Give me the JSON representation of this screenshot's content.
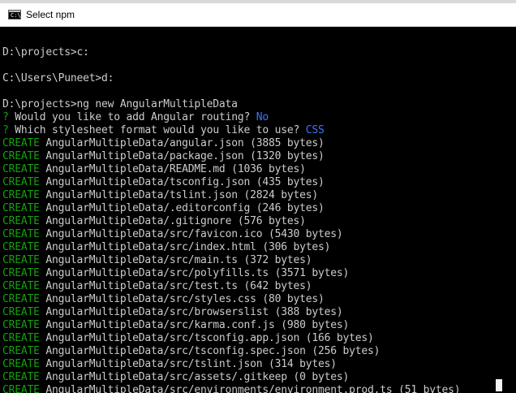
{
  "window": {
    "title": "Select npm",
    "icon_text": "C:\\_"
  },
  "console": {
    "lines": [
      {
        "type": "plain",
        "text": ""
      },
      {
        "type": "plain",
        "text": "D:\\projects>c:"
      },
      {
        "type": "plain",
        "text": ""
      },
      {
        "type": "plain",
        "text": "C:\\Users\\Puneet>d:"
      },
      {
        "type": "plain",
        "text": ""
      },
      {
        "type": "plain",
        "text": "D:\\projects>ng new AngularMultipleData"
      },
      {
        "type": "prompt",
        "prefix": "? ",
        "text": "Would you like to add Angular routing? ",
        "answer": "No"
      },
      {
        "type": "prompt",
        "prefix": "? ",
        "text": "Which stylesheet format would you like to use? ",
        "answer": "CSS"
      },
      {
        "type": "create",
        "prefix": "CREATE ",
        "text": "AngularMultipleData/angular.json (3885 bytes)"
      },
      {
        "type": "create",
        "prefix": "CREATE ",
        "text": "AngularMultipleData/package.json (1320 bytes)"
      },
      {
        "type": "create",
        "prefix": "CREATE ",
        "text": "AngularMultipleData/README.md (1036 bytes)"
      },
      {
        "type": "create",
        "prefix": "CREATE ",
        "text": "AngularMultipleData/tsconfig.json (435 bytes)"
      },
      {
        "type": "create",
        "prefix": "CREATE ",
        "text": "AngularMultipleData/tslint.json (2824 bytes)"
      },
      {
        "type": "create",
        "prefix": "CREATE ",
        "text": "AngularMultipleData/.editorconfig (246 bytes)"
      },
      {
        "type": "create",
        "prefix": "CREATE ",
        "text": "AngularMultipleData/.gitignore (576 bytes)"
      },
      {
        "type": "create",
        "prefix": "CREATE ",
        "text": "AngularMultipleData/src/favicon.ico (5430 bytes)"
      },
      {
        "type": "create",
        "prefix": "CREATE ",
        "text": "AngularMultipleData/src/index.html (306 bytes)"
      },
      {
        "type": "create",
        "prefix": "CREATE ",
        "text": "AngularMultipleData/src/main.ts (372 bytes)"
      },
      {
        "type": "create",
        "prefix": "CREATE ",
        "text": "AngularMultipleData/src/polyfills.ts (3571 bytes)"
      },
      {
        "type": "create",
        "prefix": "CREATE ",
        "text": "AngularMultipleData/src/test.ts (642 bytes)"
      },
      {
        "type": "create",
        "prefix": "CREATE ",
        "text": "AngularMultipleData/src/styles.css (80 bytes)"
      },
      {
        "type": "create",
        "prefix": "CREATE ",
        "text": "AngularMultipleData/src/browserslist (388 bytes)"
      },
      {
        "type": "create",
        "prefix": "CREATE ",
        "text": "AngularMultipleData/src/karma.conf.js (980 bytes)"
      },
      {
        "type": "create",
        "prefix": "CREATE ",
        "text": "AngularMultipleData/src/tsconfig.app.json (166 bytes)"
      },
      {
        "type": "create",
        "prefix": "CREATE ",
        "text": "AngularMultipleData/src/tsconfig.spec.json (256 bytes)"
      },
      {
        "type": "create",
        "prefix": "CREATE ",
        "text": "AngularMultipleData/src/tslint.json (314 bytes)"
      },
      {
        "type": "create",
        "prefix": "CREATE ",
        "text": "AngularMultipleData/src/assets/.gitkeep (0 bytes)"
      },
      {
        "type": "create",
        "prefix": "CREATE ",
        "text": "AngularMultipleData/src/environments/environment.prod.ts (51 bytes)"
      }
    ]
  },
  "colors": {
    "background": "#000000",
    "text": "#cccccc",
    "create": "#13a10e",
    "answer": "#3b78ff",
    "titlebar": "#ffffff"
  }
}
